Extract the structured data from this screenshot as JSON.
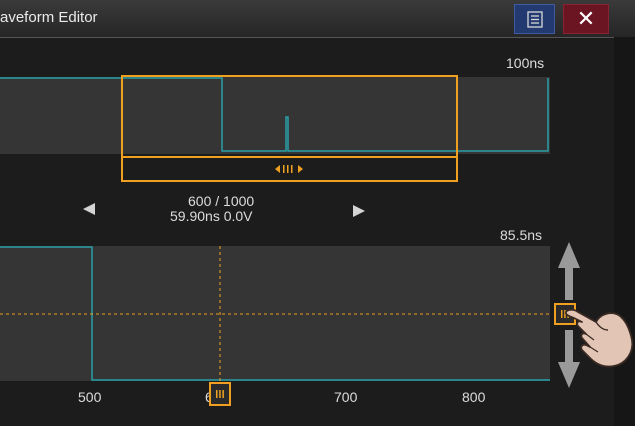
{
  "window": {
    "title": "aveform Editor"
  },
  "titlebar": {
    "menu_icon": "list-icon",
    "close_label": "✕"
  },
  "overview": {
    "time_per_div": "100ns",
    "slider_icon": "grip-icon"
  },
  "navigation": {
    "prev_icon": "triangle-left-icon",
    "next_icon": "triangle-right-icon",
    "position": "600 / 1000",
    "readout": "59.90ns   0.0V"
  },
  "detail": {
    "time_per_div": "85.5ns",
    "x_ticks": [
      "500",
      "6",
      "700",
      "800"
    ],
    "cursor_x": 600,
    "level_v": 0.0
  },
  "colors": {
    "accent": "#f0a020",
    "trace": "#2aa0a8",
    "panel": "#353535",
    "close": "#6b1522",
    "menu": "#223a70"
  }
}
